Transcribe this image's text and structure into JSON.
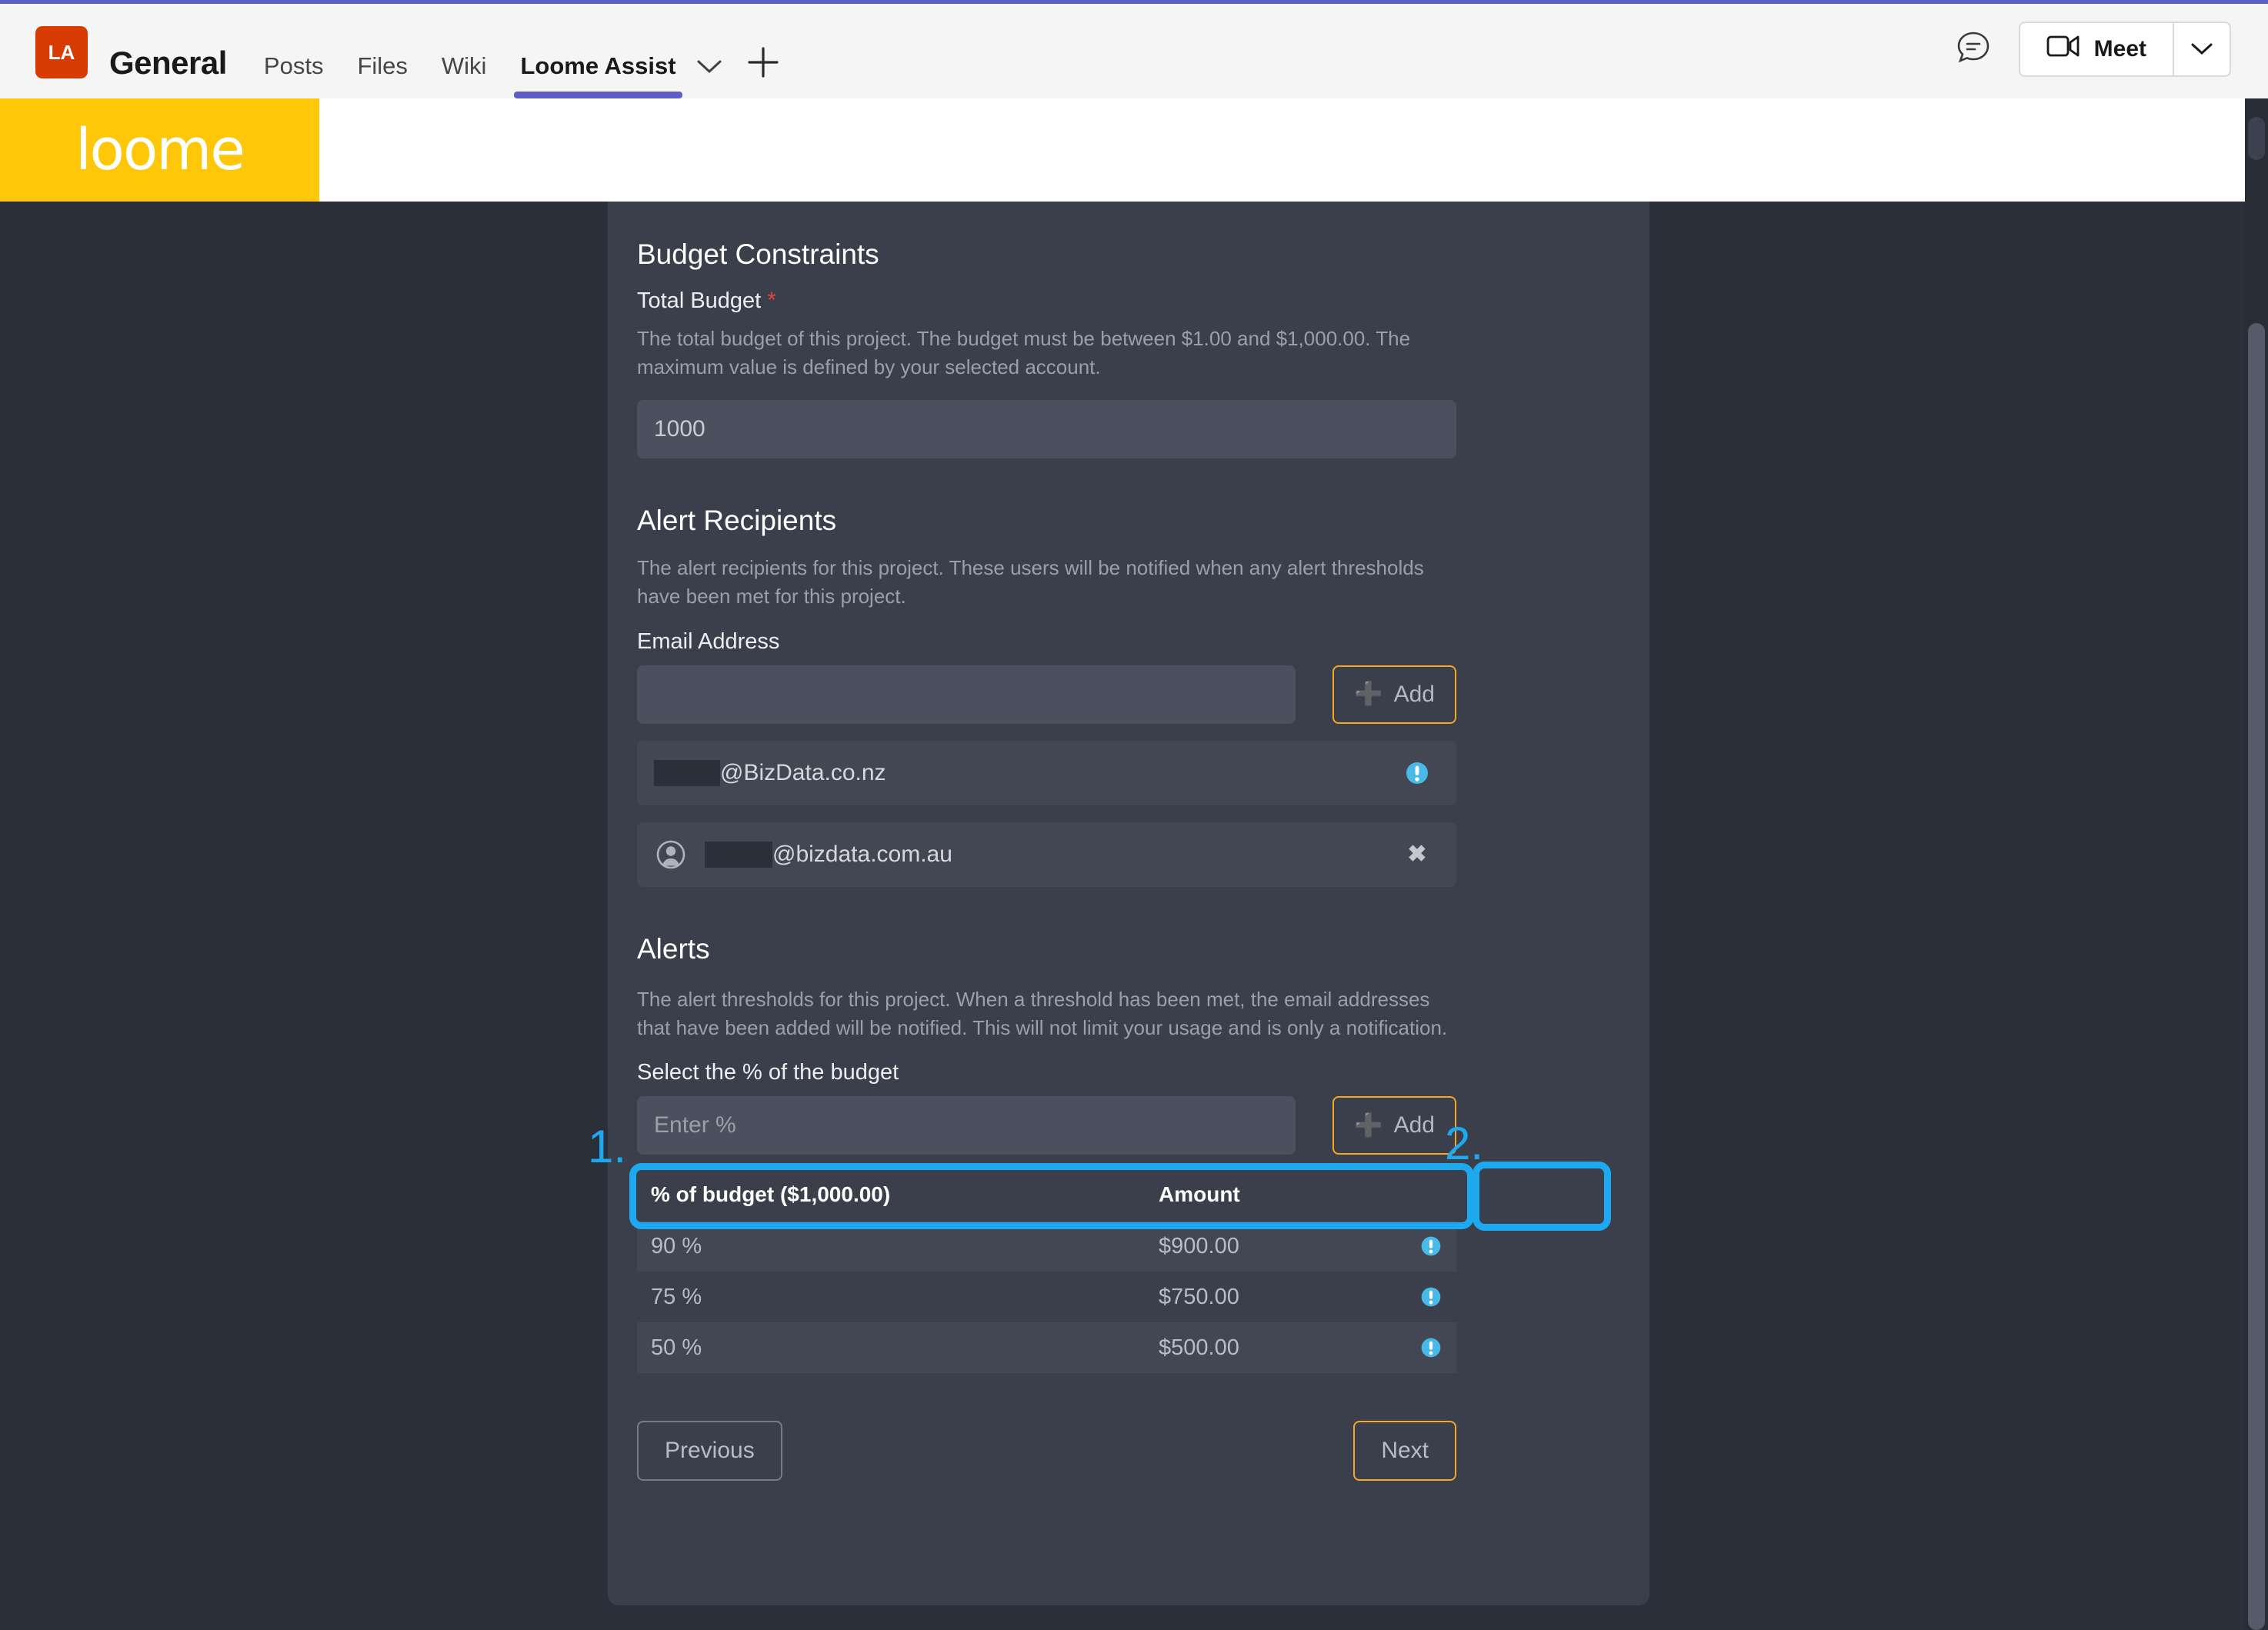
{
  "teams_bar": {
    "avatar_initials": "LA",
    "channel_title": "General",
    "tabs": [
      {
        "label": "Posts",
        "active": false
      },
      {
        "label": "Files",
        "active": false
      },
      {
        "label": "Wiki",
        "active": false
      },
      {
        "label": "Loome Assist",
        "active": true
      }
    ],
    "tab_chevron_icon": "chevron-down-icon",
    "add_tab_icon": "plus-icon",
    "chat_icon": "chat-bubble-icon",
    "meet_label": "Meet",
    "meet_video_icon": "video-camera-icon",
    "meet_chevron_icon": "chevron-down-icon"
  },
  "loome_header": {
    "logo_text": "loome",
    "logo_bg": "#ffc709"
  },
  "budget": {
    "section_title": "Budget Constraints",
    "total_budget_label": "Total Budget",
    "required_marker": "*",
    "helper": "The total budget of this project. The budget must be between $1.00 and $1,000.00. The maximum value is defined by your selected account.",
    "total_budget_value": "1000"
  },
  "recipients": {
    "section_title": "Alert Recipients",
    "helper": "The alert recipients for this project. These users will be notified when any alert thresholds have been met for this project.",
    "email_label": "Email Address",
    "email_input_value": "",
    "email_input_placeholder": "",
    "add_label": "Add",
    "add_plus_icon": "plus-icon",
    "rows": [
      {
        "redacted": true,
        "redacted_width": 86,
        "domain": "@BizData.co.nz",
        "has_person_icon": false,
        "action_icon": "info-icon",
        "action_label": "!"
      },
      {
        "redacted": true,
        "redacted_width": 88,
        "domain": "@bizdata.com.au",
        "has_person_icon": true,
        "action_icon": "close-icon",
        "action_label": "✖"
      }
    ]
  },
  "alerts": {
    "section_title": "Alerts",
    "helper": "The alert thresholds for this project. When a threshold has been met, the email addresses that have been added will be notified. This will not limit your usage and is only a notification.",
    "percent_label": "Select the % of the budget",
    "percent_input_value": "",
    "percent_input_placeholder": "Enter %",
    "add_label": "Add",
    "add_plus_icon": "plus-icon",
    "table": {
      "headers": [
        "% of budget ($1,000.00)",
        "Amount"
      ],
      "rows": [
        {
          "percent": "90 %",
          "amount": "$900.00",
          "info_icon": "info-icon"
        },
        {
          "percent": "75 %",
          "amount": "$750.00",
          "info_icon": "info-icon"
        },
        {
          "percent": "50 %",
          "amount": "$500.00",
          "info_icon": "info-icon"
        }
      ]
    }
  },
  "footer": {
    "previous_label": "Previous",
    "next_label": "Next"
  },
  "annotations": {
    "color": "#1ca9ef",
    "marker_1": "1.",
    "marker_2": "2."
  },
  "colors": {
    "accent_orange": "#f5a623",
    "brand_yellow": "#ffc709",
    "teams_purple": "#5b5fc7",
    "panel_bg": "#3a3f4b",
    "app_bg": "#2b2f3a",
    "info_blue": "#49b9e8",
    "required_red": "#e8443a"
  }
}
